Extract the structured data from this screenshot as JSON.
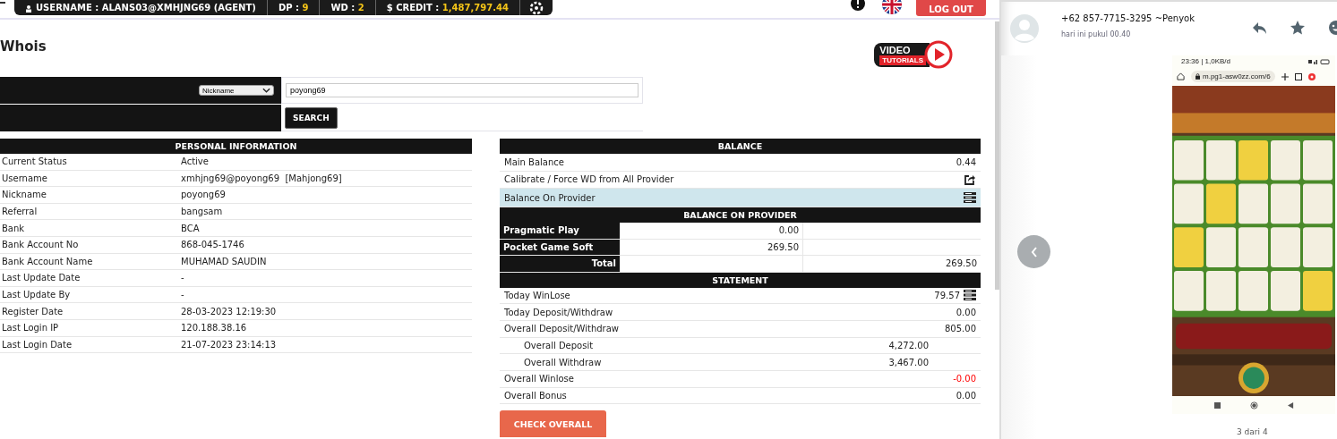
{
  "top_bar": {
    "username": "USERNAME : ALANS03@XMHJNG69 (AGENT)",
    "dp_label": "DP : ",
    "dp": "9",
    "wd_label": "WD : ",
    "wd": "2",
    "credit_label": "$ CREDIT : ",
    "credit": "1,487,797.44",
    "logout": "LOG OUT"
  },
  "page_title": "Whois",
  "video_logo": {
    "top": "VIDEO",
    "bottom": "TUTORIALS"
  },
  "search_form": {
    "field": "Nickname",
    "value": "poyong69",
    "button": "SEARCH"
  },
  "personal_information": {
    "title": "PERSONAL INFORMATION",
    "rows": [
      {
        "label": "Current Status",
        "value": "Active"
      },
      {
        "label": "Username",
        "value": "xmhjng69@poyong69  [Mahjong69]"
      },
      {
        "label": "Nickname",
        "value": "poyong69"
      },
      {
        "label": "Referral",
        "value": "bangsam"
      },
      {
        "label": "Bank",
        "value": "BCA"
      },
      {
        "label": "Bank Account No",
        "value": "868-045-1746"
      },
      {
        "label": "Bank Account Name",
        "value": "MUHAMAD SAUDIN"
      },
      {
        "label": "Last Update Date",
        "value": "-"
      },
      {
        "label": "Last Update By",
        "value": "-"
      },
      {
        "label": "Register Date",
        "value": "28-03-2023 12:19:30"
      },
      {
        "label": "Last Login IP",
        "value": "120.188.38.16"
      },
      {
        "label": "Last Login Date",
        "value": "21-07-2023 23:14:13"
      }
    ]
  },
  "balance": {
    "title": "BALANCE",
    "rows": [
      {
        "kind": "value",
        "label": "Main Balance",
        "value": "0.44",
        "highlighted": false
      },
      {
        "kind": "action",
        "label": "Calibrate / Force WD from All Provider",
        "highlighted": false
      },
      {
        "kind": "list",
        "label": "Balance On Provider",
        "highlighted": true
      }
    ]
  },
  "balance_on_provider": {
    "title": "BALANCE ON PROVIDER",
    "rows": [
      {
        "name": "Pragmatic Play",
        "amount": "0.00"
      },
      {
        "name": "Pocket Game Soft",
        "amount": "269.50"
      }
    ],
    "total_label": "Total",
    "total": "269.50"
  },
  "statement": {
    "title": "STATEMENT",
    "rows": [
      {
        "kind": "main",
        "label": "Today WinLose",
        "value": "79.57",
        "has_detail": true,
        "negative": false
      },
      {
        "kind": "main",
        "label": "Today Deposit/Withdraw",
        "value": "0.00",
        "has_detail": false,
        "negative": false
      },
      {
        "kind": "main",
        "label": "Overall Deposit/Withdraw",
        "value": "805.00",
        "has_detail": false,
        "negative": false
      },
      {
        "kind": "sub",
        "label": "Overall Deposit",
        "value": "4,272.00",
        "has_detail": false,
        "negative": false
      },
      {
        "kind": "sub",
        "label": "Overall Withdraw",
        "value": "3,467.00",
        "has_detail": false,
        "negative": false
      },
      {
        "kind": "main",
        "label": "Overall Winlose",
        "value": "-0.00",
        "has_detail": false,
        "negative": true
      },
      {
        "kind": "main",
        "label": "Overall Bonus",
        "value": "0.00",
        "has_detail": false,
        "negative": false
      }
    ],
    "button": "CHECK OVERALL"
  },
  "media_viewer": {
    "sender": "+62 857-7715-3295 ~Penyok",
    "time": "hari ini pukul 00.40",
    "counter": "3 dari 4",
    "phone": {
      "status": "23:36 | 1,0KB/d",
      "url": "m.pg1-asw0zz.com/6"
    }
  }
}
